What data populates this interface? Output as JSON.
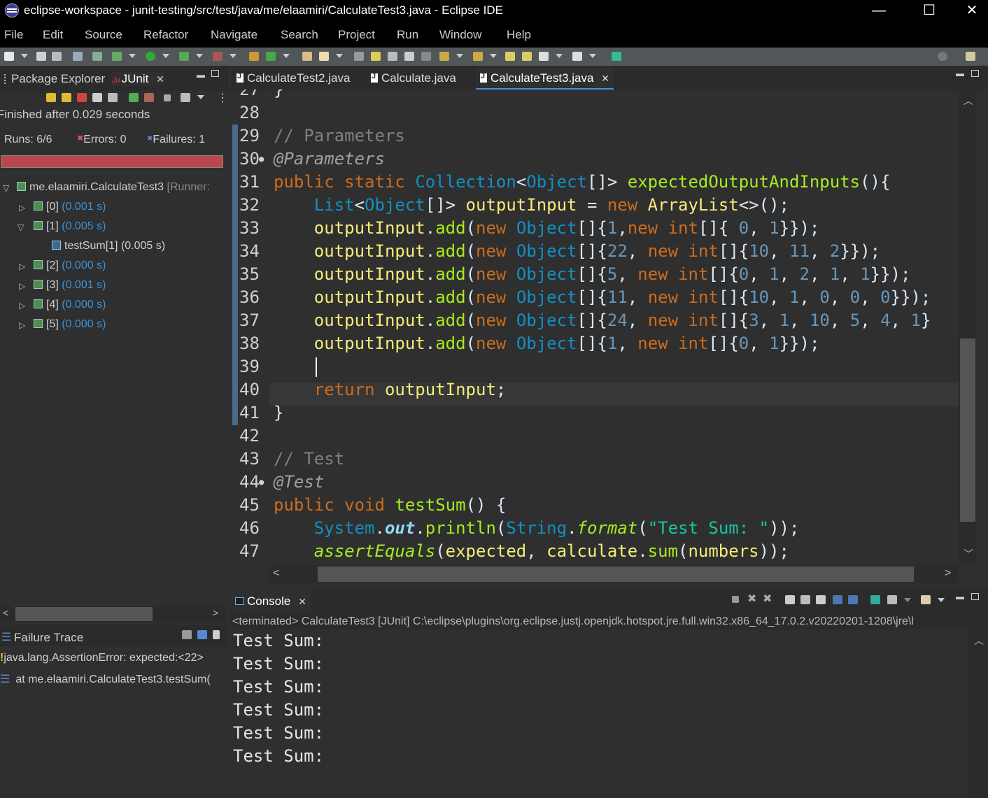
{
  "window": {
    "title": "eclipse-workspace - junit-testing/src/test/java/me/elaamiri/CalculateTest3.java - Eclipse IDE",
    "minimize": "—",
    "maximize": "☐",
    "close": "✕"
  },
  "menu": [
    "File",
    "Edit",
    "Source",
    "Refactor",
    "Navigate",
    "Search",
    "Project",
    "Run",
    "Window",
    "Help"
  ],
  "left_panel": {
    "tabs": {
      "package_explorer": "Package Explorer",
      "junit": "JUnit",
      "junit_icon": "Ju"
    },
    "status": "Finished after 0.029 seconds",
    "runs_label": "Runs:",
    "runs_value": "6/6",
    "errors_label": "Errors:",
    "errors_value": "0",
    "failures_label": "Failures:",
    "failures_value": "1",
    "progress_color": "#b9474d",
    "tree": {
      "root_name": "me.elaamiri.CalculateTest3",
      "root_runner": "[Runner:",
      "items": [
        {
          "name": "[0]",
          "time": "(0.001 s)"
        },
        {
          "name": "[1]",
          "time": "(0.005 s)"
        },
        {
          "name": "testSum[1]",
          "time": "(0.005 s)"
        },
        {
          "name": "[2]",
          "time": "(0.000 s)"
        },
        {
          "name": "[3]",
          "time": "(0.001 s)"
        },
        {
          "name": "[4]",
          "time": "(0.000 s)"
        },
        {
          "name": "[5]",
          "time": "(0.000 s)"
        }
      ]
    },
    "failure_trace": {
      "title": "Failure Trace",
      "line1": "java.lang.AssertionError: expected:<22>",
      "line2": "at me.elaamiri.CalculateTest3.testSum("
    }
  },
  "editor": {
    "tabs": [
      "CalculateTest2.java",
      "Calculate.java",
      "CalculateTest3.java"
    ],
    "active_tab": "CalculateTest3.java",
    "line_numbers": [
      "27",
      "28",
      "29",
      "30",
      "31",
      "32",
      "33",
      "34",
      "35",
      "36",
      "37",
      "38",
      "39",
      "40",
      "41",
      "42",
      "43",
      "44",
      "45",
      "46",
      "47"
    ],
    "code_text": {
      "l27": "}",
      "l29": "// Parameters",
      "l30": "@Parameters",
      "l31": "public static Collection<Object[]> expectedOutputAndInputs(){",
      "l32": "List<Object[]> outputInput = new ArrayList<>();",
      "l33": "outputInput.add(new Object[]{1,new int[]{ 0, 1}});",
      "l34": "outputInput.add(new Object[]{22, new int[]{10, 11, 2}});",
      "l35": "outputInput.add(new Object[]{5, new int[]{0, 1, 2, 1, 1}});",
      "l36": "outputInput.add(new Object[]{11, new int[]{10, 1, 0, 0, 0}});",
      "l37": "outputInput.add(new Object[]{24, new int[]{3, 1, 10, 5, 4, 1}",
      "l38": "outputInput.add(new Object[]{1, new int[]{0, 1}});",
      "l40": "return outputInput;",
      "l41": "}",
      "l43": "// Test",
      "l44": "@Test",
      "l45": "public void testSum() {",
      "l46": "System.out.println(String.format(\"Test Sum: \"));",
      "l47": "assertEquals(expected, calculate.sum(numbers));"
    }
  },
  "console": {
    "tab": "Console",
    "status": "<terminated> CalculateTest3 [JUnit] C:\\eclipse\\plugins\\org.eclipse.justj.openjdk.hotspot.jre.full.win32.x86_64_17.0.2.v20220201-1208\\jre\\l",
    "lines": [
      "Test Sum:",
      "Test Sum:",
      "Test Sum:",
      "Test Sum:",
      "Test Sum:",
      "Test Sum:"
    ]
  }
}
